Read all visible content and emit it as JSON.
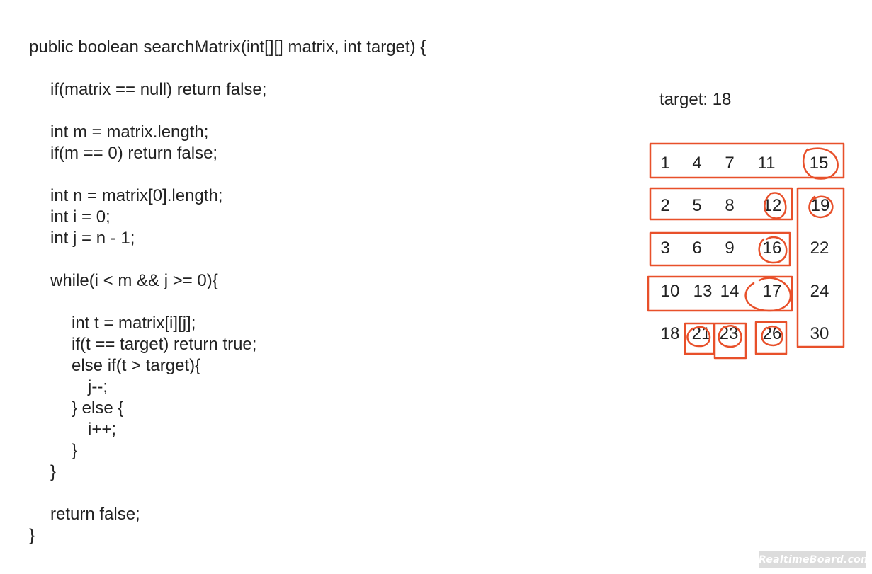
{
  "code": {
    "lines": [
      "public boolean searchMatrix(int[][] matrix, int target) {",
      "if(matrix == null) return false;",
      "int m = matrix.length;",
      "if(m == 0) return false;",
      "int n = matrix[0].length;",
      "int i = 0;",
      "int j = n - 1;",
      "while(i < m && j >= 0){",
      "int t = matrix[i][j];",
      "if(t == target) return true;",
      "else if(t > target){",
      "j--;",
      "} else {",
      "i++;",
      "}",
      "}",
      "return false;",
      "}"
    ]
  },
  "target_label": "target: 18",
  "matrix": {
    "rows": [
      [
        "1",
        "4",
        "7",
        "11",
        "15"
      ],
      [
        "2",
        "5",
        "8",
        "12",
        "19"
      ],
      [
        "3",
        "6",
        "9",
        "16",
        "22"
      ],
      [
        "10",
        "13",
        "14",
        "17",
        "24"
      ],
      [
        "18",
        "21",
        "23",
        "26",
        "30"
      ]
    ]
  },
  "colors": {
    "text": "#222222",
    "annotation": "#e8502a",
    "watermark_bg": "#dcdcdc"
  },
  "watermark": "RealtimeBoard.com"
}
